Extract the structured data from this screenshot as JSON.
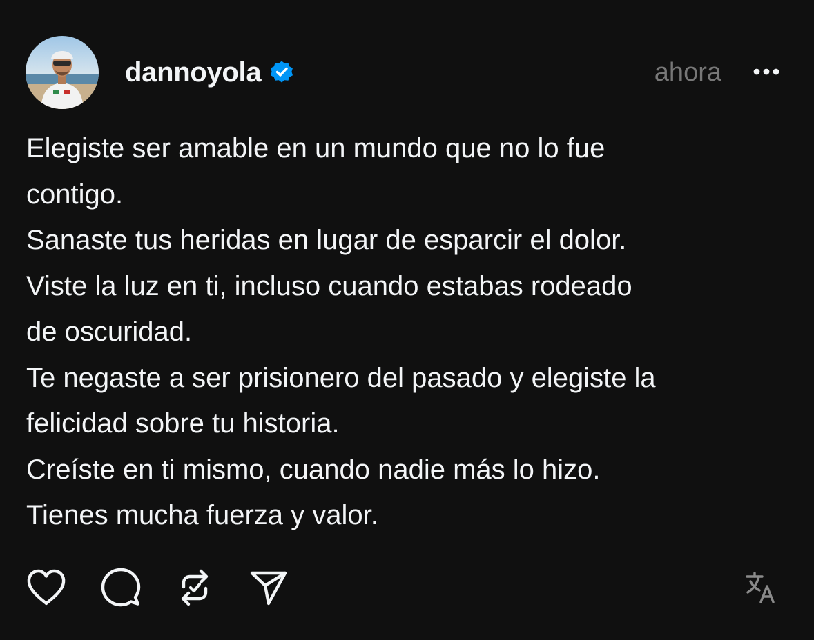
{
  "post": {
    "username": "dannoyola",
    "verified": true,
    "timestamp": "ahora",
    "more_icon": "more-horizontal-icon",
    "body_lines": [
      "Elegiste ser amable en un mundo que no lo fue",
      "contigo.",
      "Sanaste tus heridas en lugar de esparcir el dolor.",
      "Viste la luz en ti, incluso cuando estabas rodeado",
      "de oscuridad.",
      "Te negaste a ser prisionero del pasado y elegiste la",
      "felicidad sobre tu historia.",
      "Creíste en ti mismo, cuando nadie más lo hizo.",
      "Tienes mucha fuerza y valor."
    ]
  },
  "actions": {
    "icons": [
      "heart-icon",
      "comment-icon",
      "repost-icon",
      "send-icon",
      "translate-icon"
    ]
  },
  "colors": {
    "background": "#101010",
    "text": "#f3f5f7",
    "muted": "#777777",
    "verified": "#0095f6"
  }
}
